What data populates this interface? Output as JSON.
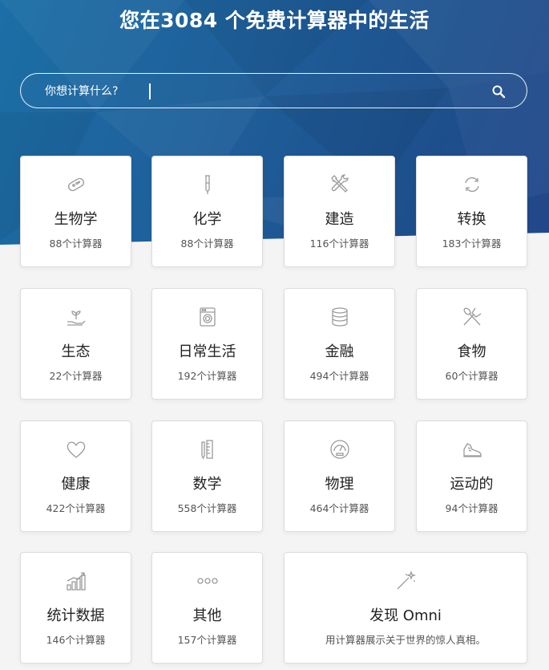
{
  "header": {
    "title": "您在3084 个免费计算器中的生活"
  },
  "search": {
    "placeholder": "你想计算什么?",
    "icon": "search-icon"
  },
  "colors": {
    "hero_start": "#1b6fa6",
    "hero_end": "#23468a",
    "card_bg": "#ffffff",
    "icon_stroke": "#9a9a9a"
  },
  "categories": [
    {
      "label": "生物学",
      "count": "88个计算器",
      "icon": "bacteria-icon"
    },
    {
      "label": "化学",
      "count": "88个计算器",
      "icon": "test-tube-icon"
    },
    {
      "label": "建造",
      "count": "116个计算器",
      "icon": "tools-icon"
    },
    {
      "label": "转换",
      "count": "183个计算器",
      "icon": "refresh-icon"
    },
    {
      "label": "生态",
      "count": "22个计算器",
      "icon": "plant-hand-icon"
    },
    {
      "label": "日常生活",
      "count": "192个计算器",
      "icon": "washing-machine-icon"
    },
    {
      "label": "金融",
      "count": "494个计算器",
      "icon": "coins-icon"
    },
    {
      "label": "食物",
      "count": "60个计算器",
      "icon": "fork-spoon-icon"
    },
    {
      "label": "健康",
      "count": "422个计算器",
      "icon": "heart-icon"
    },
    {
      "label": "数学",
      "count": "558个计算器",
      "icon": "ruler-pencil-icon"
    },
    {
      "label": "物理",
      "count": "464个计算器",
      "icon": "gauge-icon"
    },
    {
      "label": "运动的",
      "count": "94个计算器",
      "icon": "sneaker-icon"
    },
    {
      "label": "统计数据",
      "count": "146个计算器",
      "icon": "bar-chart-icon"
    },
    {
      "label": "其他",
      "count": "157个计算器",
      "icon": "dots-icon"
    }
  ],
  "discover": {
    "label": "发现 Omni",
    "description": "用计算器展示关于世界的惊人真相。",
    "icon": "magic-wand-icon"
  }
}
